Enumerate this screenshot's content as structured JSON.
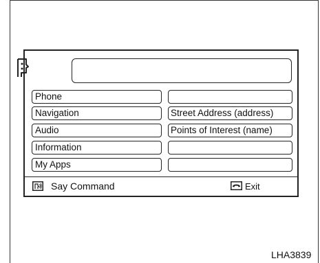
{
  "left_menu": [
    {
      "label": "Phone"
    },
    {
      "label": "Navigation"
    },
    {
      "label": "Audio"
    },
    {
      "label": "Information"
    },
    {
      "label": "My Apps"
    }
  ],
  "right_menu": [
    {
      "label": ""
    },
    {
      "label": "Street Address (address)"
    },
    {
      "label": "Points of Interest (name)"
    },
    {
      "label": ""
    },
    {
      "label": ""
    }
  ],
  "footer": {
    "say_command_label": "Say Command",
    "say_command_icon": "voice-command-icon",
    "exit_label": "Exit",
    "exit_icon": "phone-hangup-icon"
  },
  "header": {
    "speaker_icon": "voice-recognition-face-icon"
  },
  "figure_code": "LHA3839"
}
